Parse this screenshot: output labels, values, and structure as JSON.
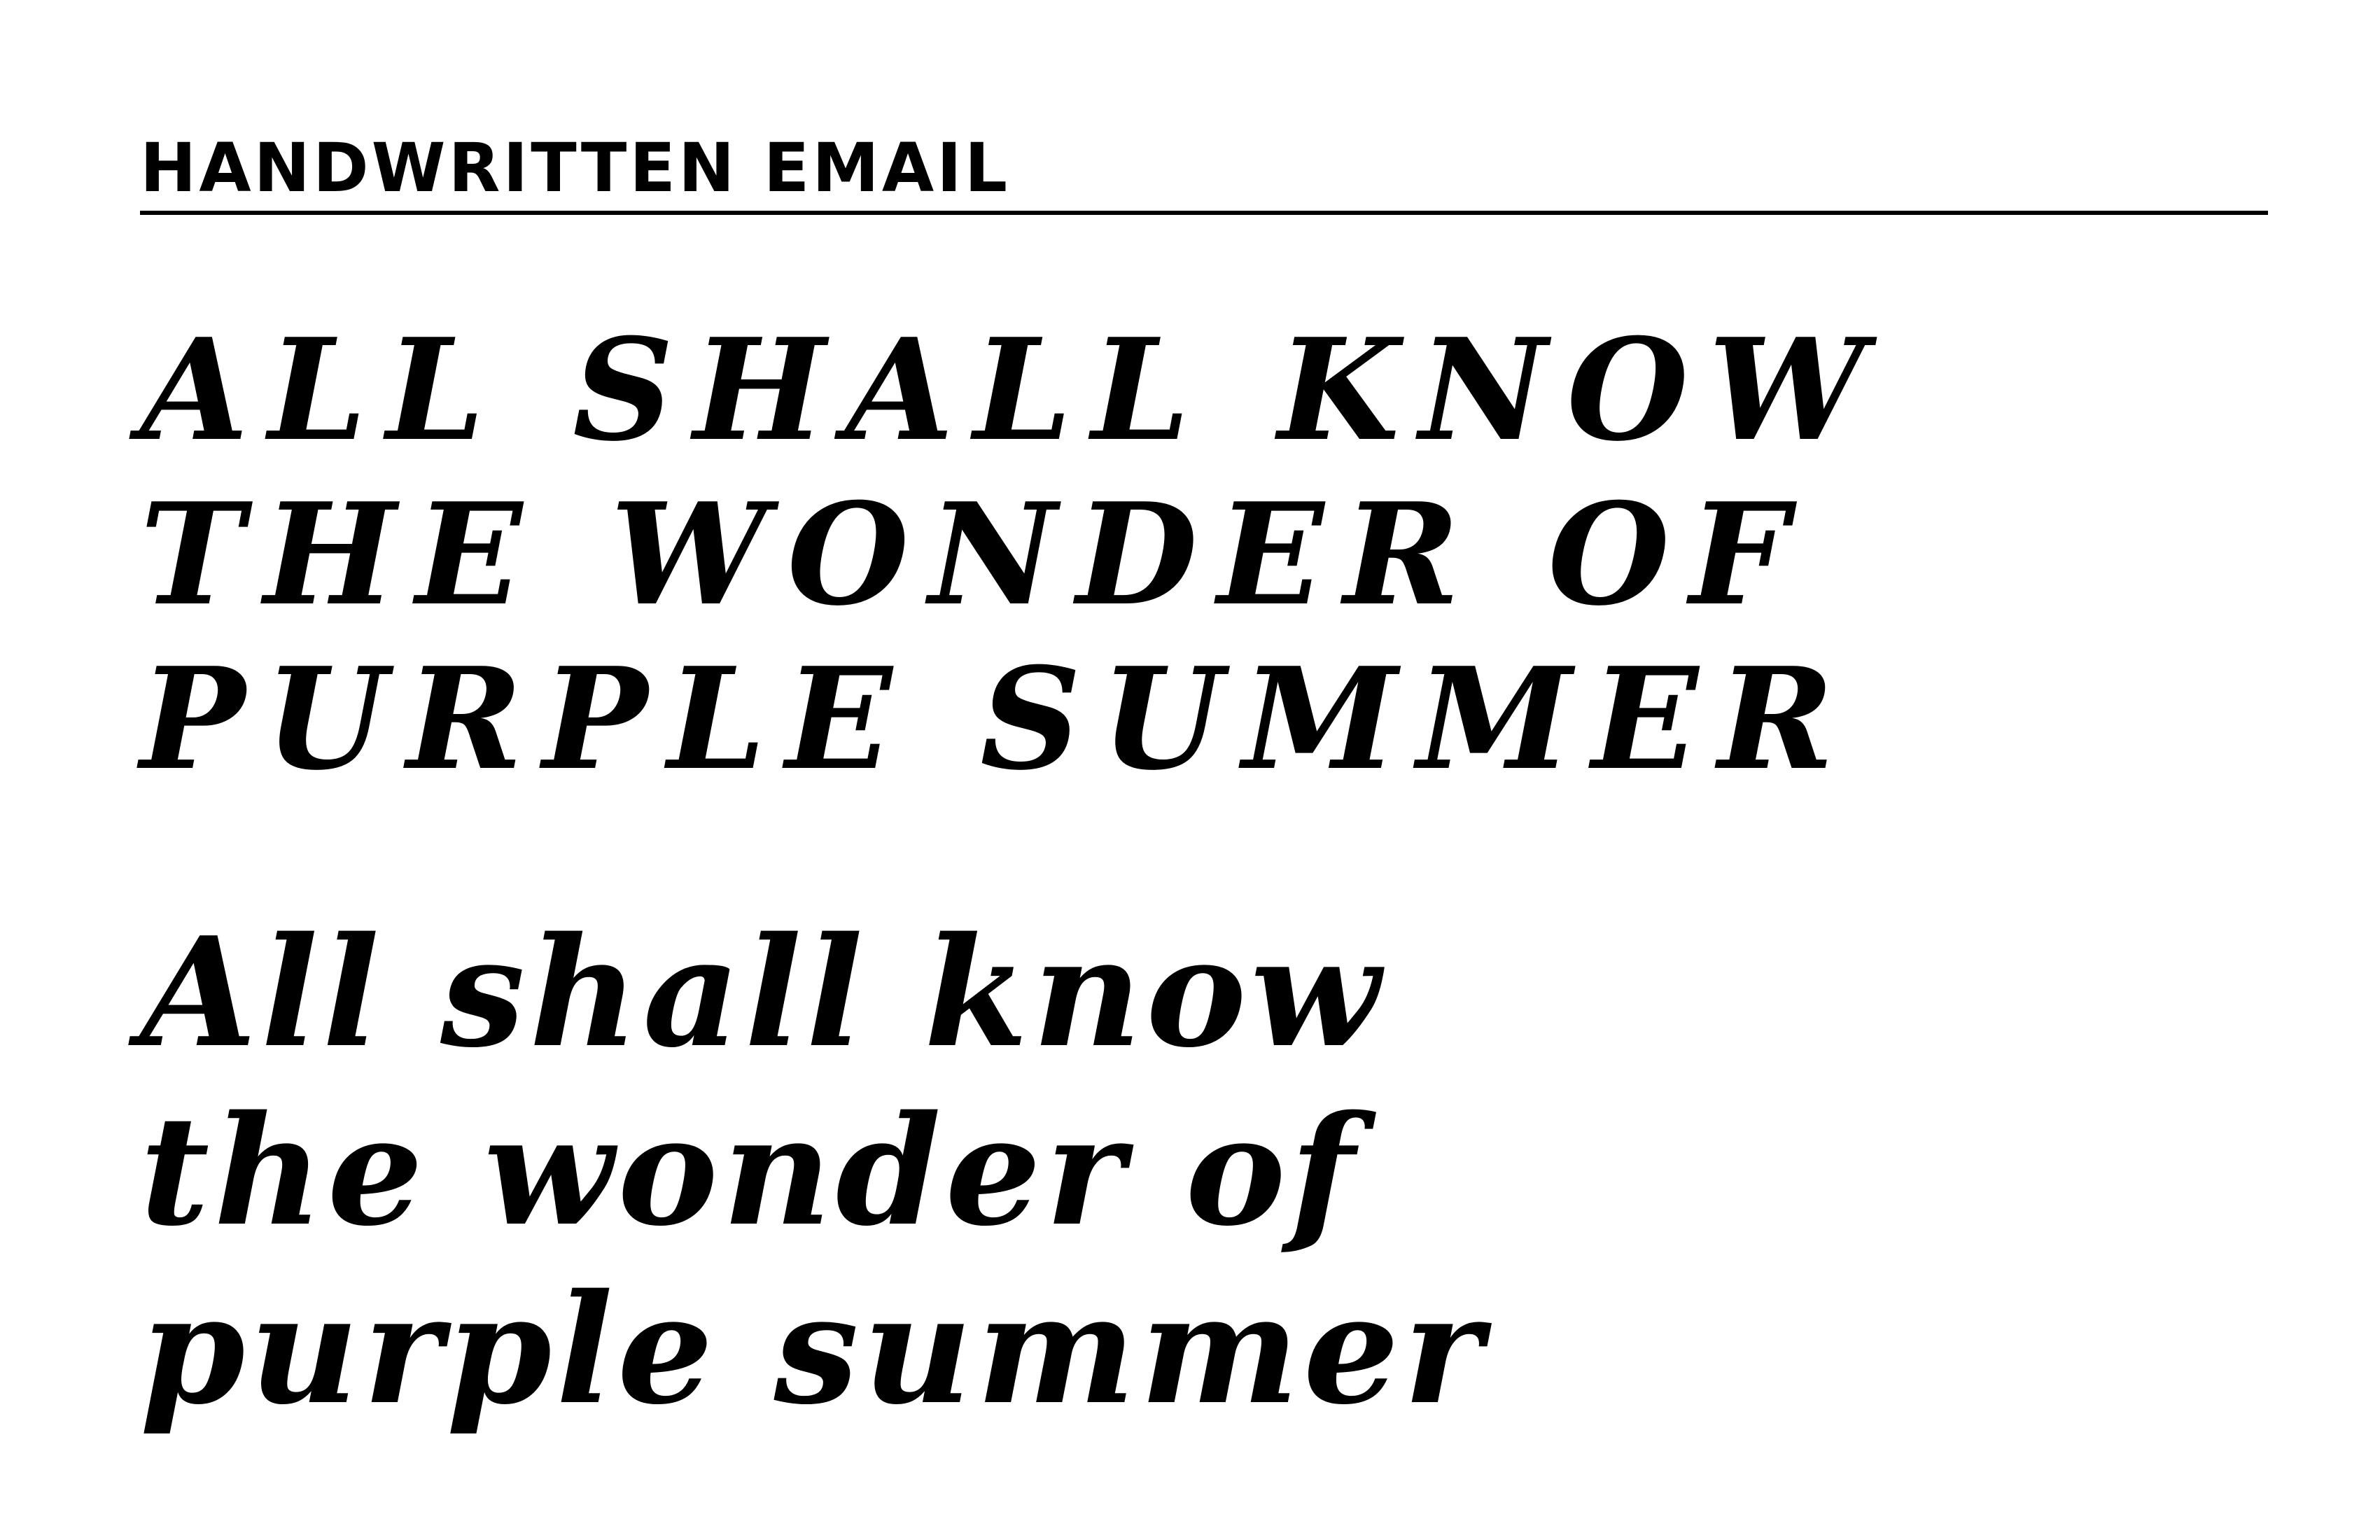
{
  "header": {
    "title": "HANDWRITTEN EMAIL"
  },
  "specimen_uppercase": {
    "lines": [
      "ALL SHALL KNOW",
      "THE WONDER OF",
      "PURPLE SUMMER"
    ]
  },
  "specimen_lowercase": {
    "lines": [
      "All shall know",
      "the wonder of",
      "purple summer"
    ]
  },
  "colors": {
    "background": "#ffffff",
    "ink": "#000000"
  }
}
